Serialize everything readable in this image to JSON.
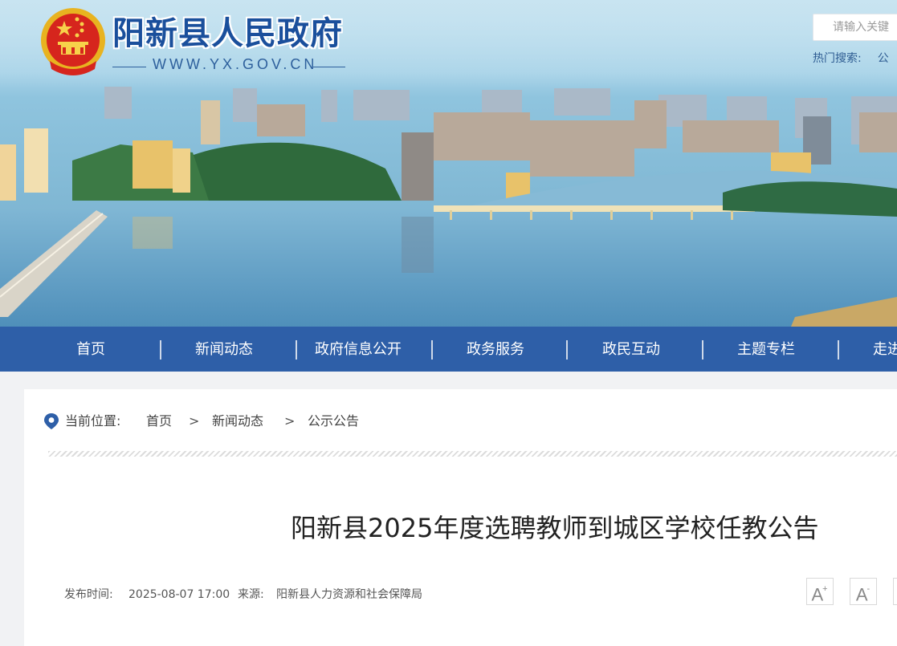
{
  "header": {
    "site_title": "阳新县人民政府",
    "site_url": "WWW.YX.GOV.CN",
    "logo_icon": "national-emblem-icon"
  },
  "search": {
    "placeholder": "请输入关键",
    "hot_label": "热门搜索:",
    "hot_items": [
      "公"
    ]
  },
  "nav": {
    "items": [
      {
        "label": "首页"
      },
      {
        "label": "新闻动态"
      },
      {
        "label": "政府信息公开"
      },
      {
        "label": "政务服务"
      },
      {
        "label": "政民互动"
      },
      {
        "label": "主题专栏"
      },
      {
        "label": "走进"
      }
    ]
  },
  "breadcrumb": {
    "icon": "location-pin-icon",
    "label": "当前位置:",
    "items": [
      "首页",
      "新闻动态",
      "公示公告"
    ],
    "separator": ">"
  },
  "article": {
    "title": "阳新县2025年度选聘教师到城区学校任教公告",
    "meta_publish_label": "发布时间:",
    "meta_publish_time": "2025-08-07 17:00",
    "meta_source_label": "来源:",
    "meta_source": "阳新县人力资源和社会保障局"
  },
  "font_controls": {
    "increase_label": "A",
    "increase_symbol": "+",
    "decrease_label": "A",
    "decrease_symbol": "-"
  },
  "colors": {
    "nav_background": "#2e5fa8",
    "title_blue": "#1a4f9c",
    "page_background": "#f1f2f4"
  }
}
